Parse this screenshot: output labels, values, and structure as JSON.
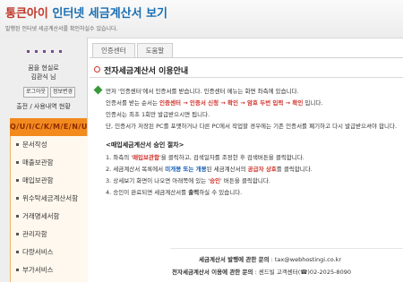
{
  "header": {
    "brand": "통큰아이",
    "title_rest": " 인터넷 세금계산서 보기",
    "subtitle": "발행된 인터넷 세금계산서를 확인하실수 있습니다."
  },
  "sidebar": {
    "welcome_line1": "꿈을 현실로",
    "welcome_line2": "김환식 님",
    "logout_label": "로그아웃",
    "profile_label": "정보변경",
    "history_label": "출전 / 사용내역 현황",
    "menu_title": "Q/U/I/C/K/M/E/N/U",
    "items": [
      {
        "label": "문서작성"
      },
      {
        "label": "매출보관함"
      },
      {
        "label": "매입보관함"
      },
      {
        "label": "위수탁세금계산서함"
      },
      {
        "label": "거래명세서함"
      },
      {
        "label": "관리자함"
      },
      {
        "label": "다량서비스"
      },
      {
        "label": "부가서비스"
      }
    ]
  },
  "tabs": [
    {
      "label": "인증센터"
    },
    {
      "label": "도움말"
    }
  ],
  "main": {
    "section_title": "전자세금계산서 이용안내",
    "intro_lines": [
      "먼저 '인증센터'에서 인증서를 받습니다. 인증센터 메뉴는 화면 좌측에 있습니다.",
      "인증서는 최초 1회만 발급받으시면 됩니다.",
      "단, 인증서가 저장된 PC를 포맷하거나 다른 PC에서 작업할 경우에는 기존 인증서를 폐기하고 다시 발급받으셔야 합니다."
    ],
    "flow_prefix": "인증서를 받는 순서는 ",
    "flow_highlight": "인증센터 → 인증서 신청 → 확인 → 암호 두번 입력 → 확인",
    "flow_suffix": " 입니다.",
    "steps_title": "<매입세금계산서 승인 절차>",
    "step1_a": "1. 좌측의 '",
    "step1_hl": "매입보관함",
    "step1_b": "'을 클릭하고, 검색일자를 조정한 후 검색버튼을 클릭합니다.",
    "step2_a": "2. 세금계산서 목록에서 ",
    "step2_hl1": "미개봉 또는 개봉",
    "step2_b": "된 세금계산서의 ",
    "step2_hl2": "공급자 상호",
    "step2_c": "를 클릭합니다.",
    "step3_a": "3. 상세보기 화면이 나오면 아래쪽에 있는 '",
    "step3_hl": "승인",
    "step3_b": "' 버튼을 클릭합니다.",
    "step4_a": "4. 승인이 완료되면 세금계산서를 ",
    "step4_hl": "출력",
    "step4_b": "하실 수 있습니다.",
    "contact1_label": "세금계산서 발행에 관한 문의",
    "contact1_value": " : tax@webhostingi.co.kr",
    "contact2_label": "전자세금계산서 이용에 관한 문의",
    "contact2_value": " : 센드빌 고객센터(☎)02-2025-8090"
  },
  "colors": {
    "accent_red": "#d0342c",
    "accent_blue": "#1a5fb4",
    "menu_orange": "#f28a1e"
  }
}
